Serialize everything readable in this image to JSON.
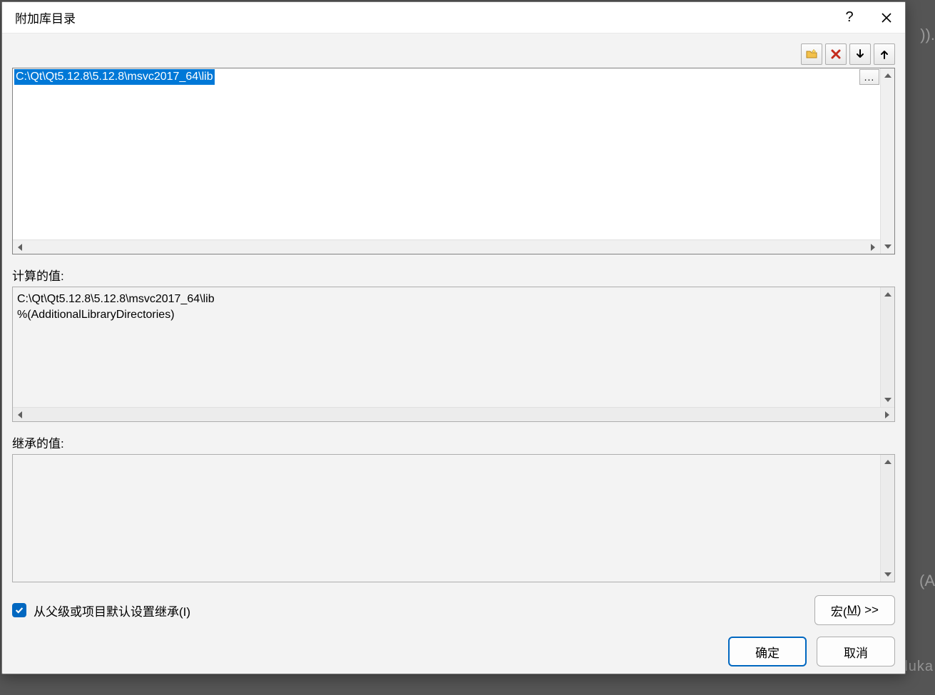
{
  "window": {
    "title": "附加库目录"
  },
  "toolbar": {
    "new_line": "new-folder",
    "delete": "delete",
    "move_down": "move-down",
    "move_up": "move-up"
  },
  "edit": {
    "entries": [
      "C:\\Qt\\Qt5.12.8\\5.12.8\\msvc2017_64\\lib"
    ],
    "browse": "..."
  },
  "computed": {
    "label": "计算的值:",
    "lines": "C:\\Qt\\Qt5.12.8\\5.12.8\\msvc2017_64\\lib\n%(AdditionalLibraryDirectories)"
  },
  "inherited": {
    "label": "继承的值:",
    "lines": ""
  },
  "inherit_checkbox": {
    "checked": true,
    "label": "从父级或项目默认设置继承(I)"
  },
  "buttons": {
    "macros_prefix": "宏(",
    "macros_key": "M",
    "macros_suffix": ") >>",
    "ok": "确定",
    "cancel": "取消"
  }
}
